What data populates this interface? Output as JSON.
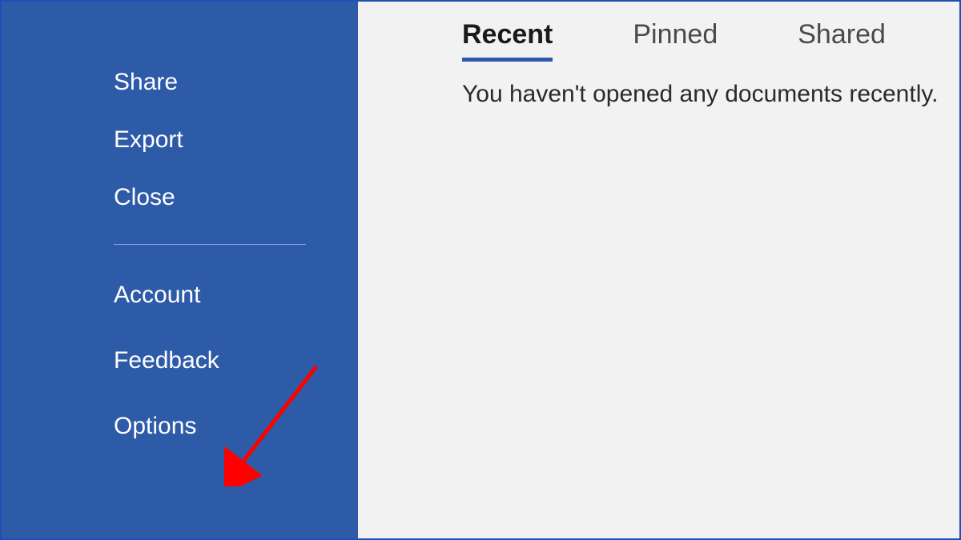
{
  "sidebar": {
    "group1": [
      {
        "label": "Share"
      },
      {
        "label": "Export"
      },
      {
        "label": "Close"
      }
    ],
    "group2": [
      {
        "label": "Account"
      },
      {
        "label": "Feedback"
      },
      {
        "label": "Options"
      }
    ]
  },
  "tabs": [
    {
      "label": "Recent",
      "active": true
    },
    {
      "label": "Pinned",
      "active": false
    },
    {
      "label": "Shared",
      "active": false
    }
  ],
  "main": {
    "empty_message": "You haven't opened any documents recently."
  }
}
